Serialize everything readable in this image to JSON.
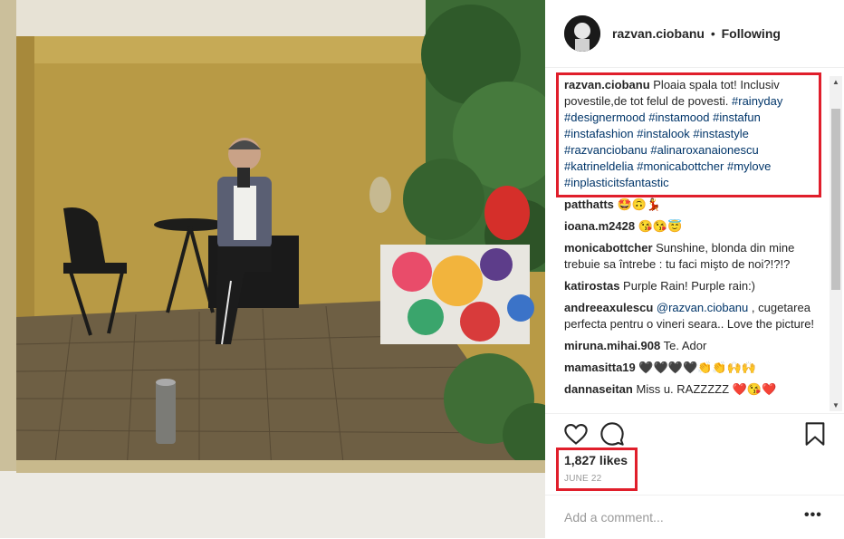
{
  "post": {
    "username": "razvan.ciobanu",
    "separator": "•",
    "follow_state": "Following",
    "caption": {
      "user": "razvan.ciobanu",
      "text": "Ploaia spala tot! Inclusiv povestile,de tot felul de povesti.",
      "hashtags": [
        "#rainyday",
        "#designermood",
        "#instamood",
        "#instafun",
        "#instafashion",
        "#instalook",
        "#instastyle",
        "#razvanciobanu",
        "#alinaroxanaionescu",
        "#katrineldelia",
        "#monicabottcher",
        "#mylove",
        "#inplasticitsfantastic"
      ]
    },
    "comments": [
      {
        "user": "patthatts",
        "text": "🤩🙃💃"
      },
      {
        "user": "ioana.m2428",
        "text": "😘😘😇"
      },
      {
        "user": "monicabottcher",
        "text": "Sunshine, blonda din mine trebuie sa întrebe : tu faci mişto de noi?!?!?"
      },
      {
        "user": "katirostas",
        "text": "Purple Rain! Purple rain:)"
      },
      {
        "user": "andreeaxulescu",
        "mention": "@razvan.ciobanu",
        "text": ", cugetarea perfecta pentru o vineri seara.. Love the picture!"
      },
      {
        "user": "miruna.mihai.908",
        "text": "Te. Ador"
      },
      {
        "user": "mamasitta19",
        "text": "🖤🖤🖤🖤👏👏🙌🙌"
      },
      {
        "user": "dannaseitan",
        "text": "Miss u. RAZZZZZ ❤️😘❤️"
      }
    ],
    "likes": "1,827 likes",
    "date": "JUNE 22",
    "add_comment_placeholder": "Add a comment...",
    "more_label": "•••"
  },
  "icons": {
    "like": "heart-icon",
    "comment": "comment-icon",
    "save": "bookmark-icon",
    "scroll_up": "arrow-up-icon",
    "scroll_down": "arrow-down-icon"
  },
  "colors": {
    "highlight": "#e01e2b",
    "hashtag": "#003569",
    "muted": "#999999"
  }
}
